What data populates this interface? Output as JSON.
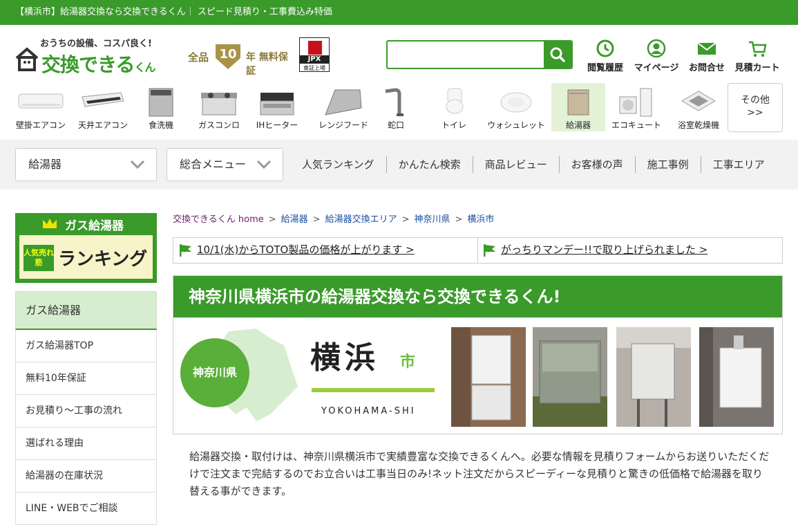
{
  "topbar": {
    "text": "【横浜市】給湯器交換なら交換できるくん｜ スピード見積り・工事費込み特価"
  },
  "logo": {
    "tagline": "おうちの設備、コスパ良く!",
    "main": "交換できる",
    "suffix": "くん"
  },
  "guarantee": {
    "pre": "全品",
    "num": "10",
    "post": "年 無料保証"
  },
  "jpx": {
    "label": "JPX",
    "sub": "東証上場"
  },
  "search": {
    "placeholder": "",
    "value": ""
  },
  "header_nav": [
    {
      "label": "閲覧履歴",
      "icon": "history-icon"
    },
    {
      "label": "マイページ",
      "icon": "user-icon"
    },
    {
      "label": "お問合せ",
      "icon": "mail-icon"
    },
    {
      "label": "見積カート",
      "icon": "cart-icon"
    }
  ],
  "categories": [
    {
      "label": "壁掛エアコン"
    },
    {
      "label": "天井エアコン"
    },
    {
      "label": "食洗機"
    },
    {
      "label": "ガスコンロ"
    },
    {
      "label": "IHヒーター"
    },
    {
      "label": "レンジフード"
    },
    {
      "label": "蛇口"
    },
    {
      "label": "トイレ"
    },
    {
      "label": "ウォシュレット"
    },
    {
      "label": "給湯器",
      "active": true
    },
    {
      "label": "エコキュート"
    },
    {
      "label": "浴室乾燥機"
    }
  ],
  "category_more": {
    "line1": "その他",
    "line2": ">>"
  },
  "navband": {
    "dropdown1": "給湯器",
    "dropdown2": "総合メニュー",
    "links": [
      "人気ランキング",
      "かんたん検索",
      "商品レビュー",
      "お客様の声",
      "施工事例",
      "工事エリア"
    ]
  },
  "ranking_banner": {
    "title": "ガス給湯器",
    "sub": "人気売れ筋",
    "word": "ランキング"
  },
  "sidebar": {
    "heading": "ガス給湯器",
    "items": [
      "ガス給湯器TOP",
      "無料10年保証",
      "お見積り～工事の流れ",
      "選ばれる理由",
      "給湯器の在庫状況",
      "LINE・WEBでご相談"
    ]
  },
  "breadcrumb": [
    "交換できるくん home",
    "給湯器",
    "給湯器交換エリア",
    "神奈川県",
    "横浜市"
  ],
  "notices": [
    "10/1(水)からTOTO製品の価格が上がります >",
    "がっちりマンデー!!で取り上げられました >"
  ],
  "hero": {
    "title": "神奈川県横浜市の給湯器交換なら交換できるくん!",
    "prefecture": "神奈川県",
    "city": "横浜",
    "shi": "市",
    "roman": "YOKOHAMA-SHI"
  },
  "intro": "給湯器交換・取付けは、神奈川県横浜市で実績豊富な交換できるくんへ。必要な情報を見積りフォームからお送りいただくだけで注文まで完結するのでお立合いは工事当日のみ!ネット注文だからスピーディーな見積りと驚きの低価格で給湯器を取り替える事ができます。",
  "colors": {
    "brand": "#3a9a2a",
    "light_green": "#d7edcf",
    "link": "#1a4e9e"
  }
}
